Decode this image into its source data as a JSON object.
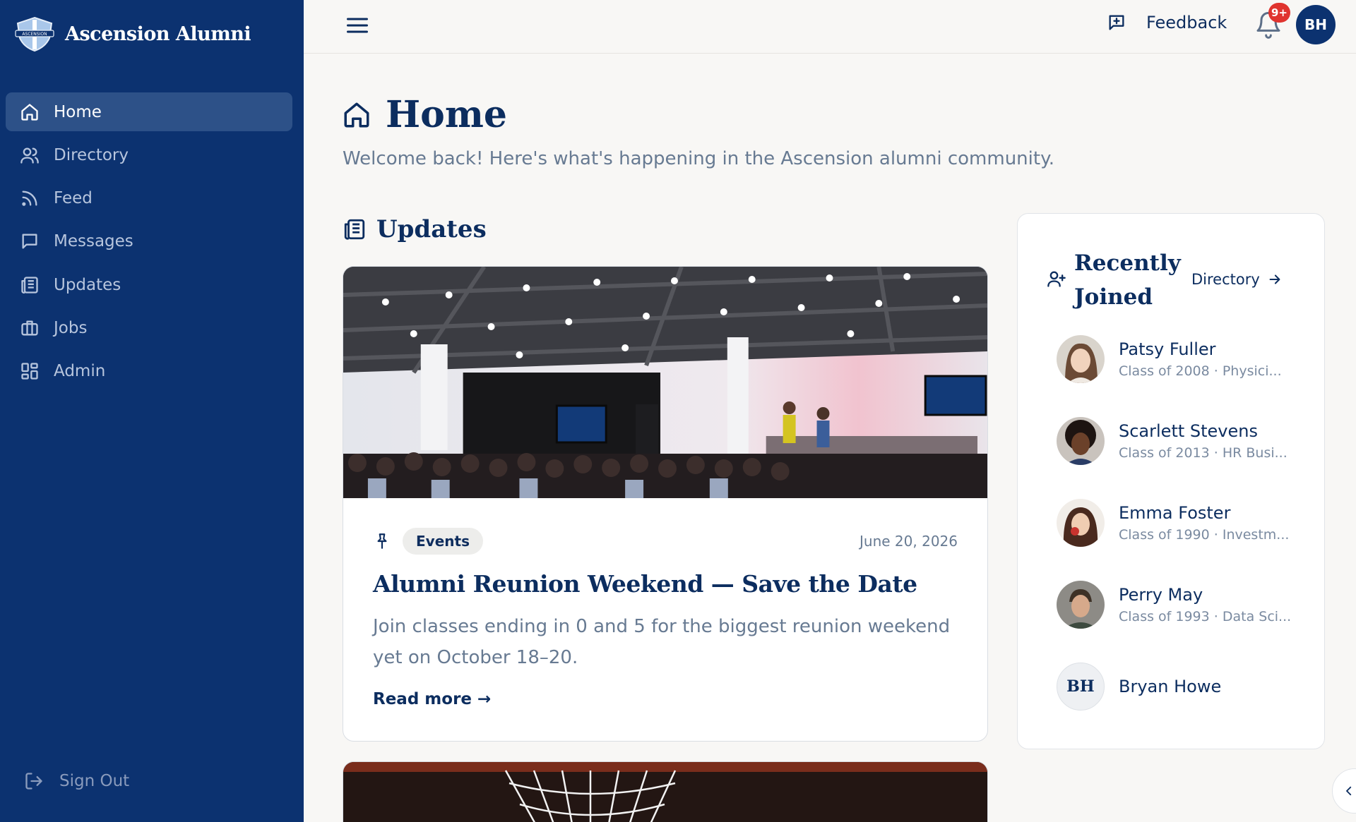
{
  "app": {
    "name": "Ascension Alumni",
    "logo_text": "ASCENSION"
  },
  "colors": {
    "sidebar": "#0c3270",
    "sidebar_active": "#2d5188",
    "accent": "#0c2d5f",
    "badge": "#e0342f"
  },
  "sidebar": {
    "items": [
      {
        "label": "Home",
        "icon": "home-icon",
        "active": true
      },
      {
        "label": "Directory",
        "icon": "users-icon"
      },
      {
        "label": "Feed",
        "icon": "rss-icon"
      },
      {
        "label": "Messages",
        "icon": "message-icon"
      },
      {
        "label": "Updates",
        "icon": "newspaper-icon"
      },
      {
        "label": "Jobs",
        "icon": "briefcase-icon"
      },
      {
        "label": "Admin",
        "icon": "grid-icon"
      }
    ],
    "sign_out": "Sign Out"
  },
  "topbar": {
    "feedback": "Feedback",
    "notifications_badge": "9+",
    "user_initials": "BH"
  },
  "page": {
    "title": "Home",
    "welcome": "Welcome back! Here's what's happening in the Ascension alumni community."
  },
  "updates": {
    "title": "Updates",
    "posts": [
      {
        "tag": "Events",
        "date": "June 20, 2026",
        "title": "Alumni Reunion Weekend — Save the Date",
        "body": "Join classes ending in 0 and 5 for the biggest reunion weekend yet on October 18–20.",
        "read_more": "Read more →"
      }
    ]
  },
  "recently_joined": {
    "title": "Recently Joined",
    "link": "Directory",
    "members": [
      {
        "name": "Patsy Fuller",
        "subtitle": "Class of 2008 · Physici..."
      },
      {
        "name": "Scarlett Stevens",
        "subtitle": "Class of 2013 · HR Busi..."
      },
      {
        "name": "Emma Foster",
        "subtitle": "Class of 1990 · Investm..."
      },
      {
        "name": "Perry May",
        "subtitle": "Class of 1993 · Data Sci..."
      },
      {
        "name": "Bryan Howe",
        "initials": "BH",
        "subtitle": ""
      }
    ]
  }
}
